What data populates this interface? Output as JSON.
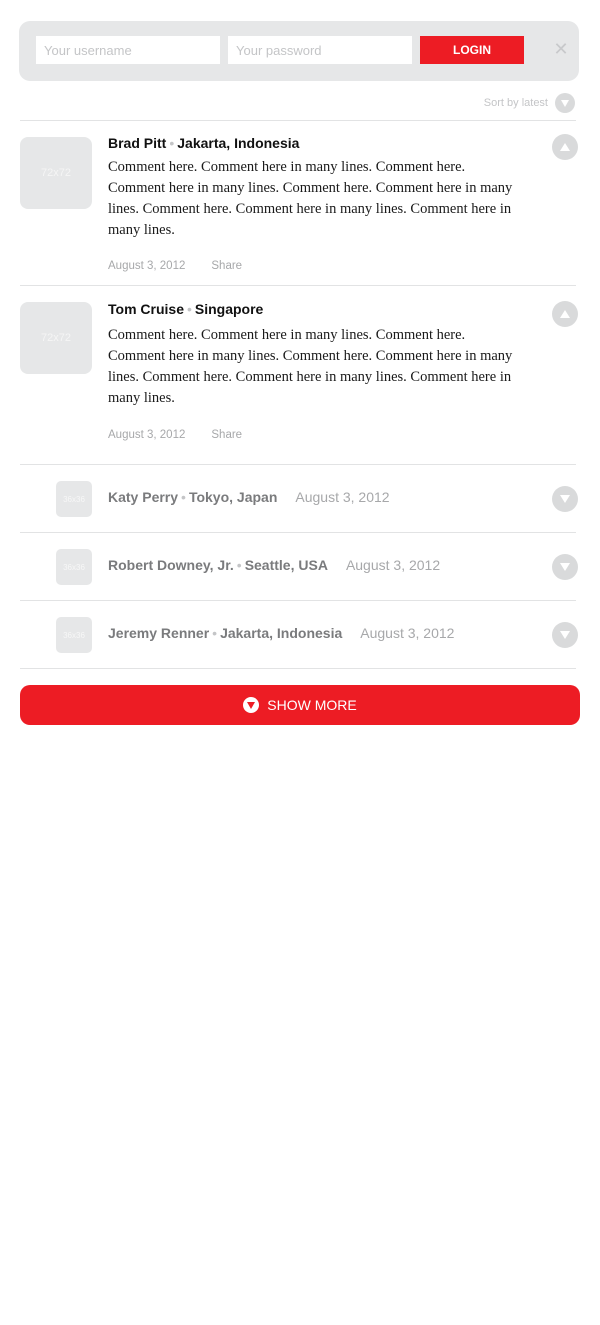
{
  "login": {
    "username_placeholder": "Your username",
    "password_placeholder": "Your password",
    "login_label": "LOGIN",
    "close_symbol": "✕"
  },
  "sort": {
    "label": "Sort by latest"
  },
  "comments": [
    {
      "author": "Brad Pitt",
      "location": "Jakarta, Indonesia",
      "avatar_label": "72x72",
      "text": "Comment here. Comment here in many lines. Comment here. Comment here in many lines. Comment here. Comment here in many lines. Comment here. Comment here in many lines. Comment here in many lines.",
      "date": "August 3, 2012",
      "share_label": "Share"
    },
    {
      "author": "Tom Cruise",
      "location": "Singapore",
      "avatar_label": "72x72",
      "text": "Comment here. Comment here in many lines. Comment here. Comment here in many lines. Comment here. Comment here in many lines. Comment here. Comment here in many lines. Comment here in many lines.",
      "date": "August 3, 2012",
      "share_label": "Share"
    }
  ],
  "collapsed": [
    {
      "author": "Katy Perry",
      "location": "Tokyo, Japan",
      "date": "August 3, 2012",
      "avatar_label": "36x36"
    },
    {
      "author": "Robert Downey, Jr.",
      "location": "Seattle, USA",
      "date": "August 3, 2012",
      "avatar_label": "36x36"
    },
    {
      "author": "Jeremy Renner",
      "location": "Jakarta, Indonesia",
      "date": "August 3, 2012",
      "avatar_label": "36x36"
    }
  ],
  "separator": "•",
  "show_more": {
    "label": "SHOW MORE"
  },
  "colors": {
    "accent": "#ed1c24",
    "panel": "#e6e7e8",
    "muted": "#a7a8aa",
    "icon_circle": "#d9dadb"
  },
  "icons": {
    "vote_up": "triangle-up-icon",
    "vote_down": "triangle-down-icon",
    "sort": "chevron-down-icon",
    "close": "close-icon"
  }
}
